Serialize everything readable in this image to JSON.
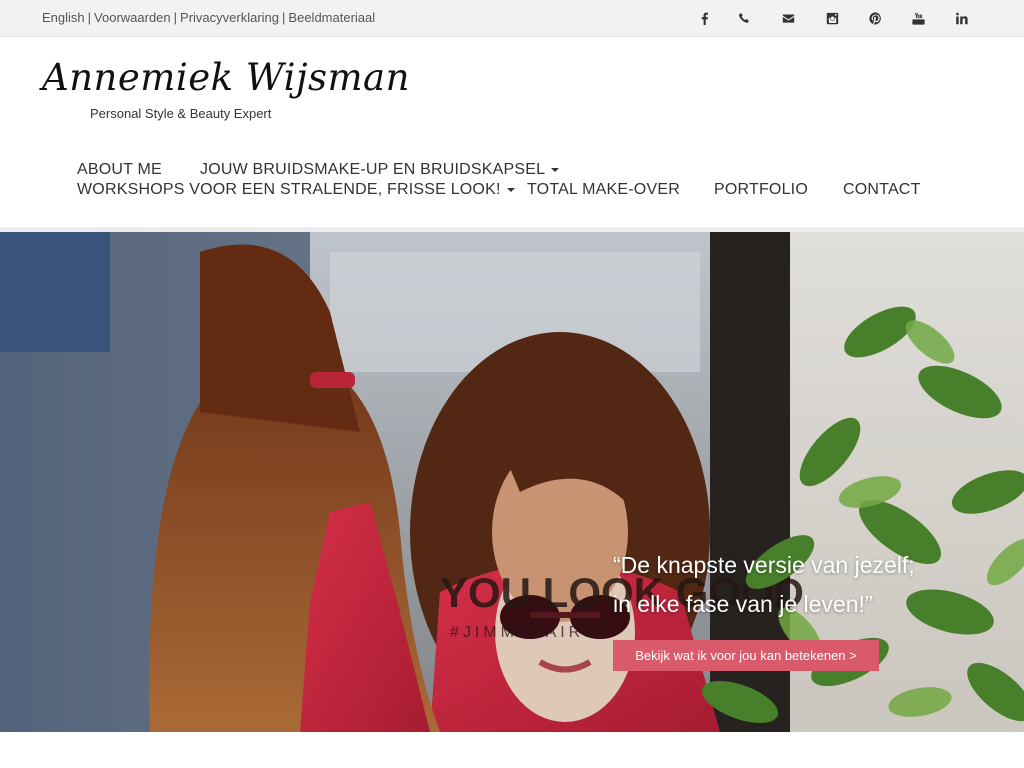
{
  "top_links": [
    {
      "label": "English"
    },
    {
      "label": "Voorwaarden"
    },
    {
      "label": "Privacyverklaring"
    },
    {
      "label": "Beeldmateriaal"
    }
  ],
  "link_separator": "|",
  "social_icons": [
    "facebook-icon",
    "phone-icon",
    "envelope-icon",
    "instagram-icon",
    "pinterest-icon",
    "youtube-icon",
    "linkedin-icon"
  ],
  "logo": {
    "name": "Annemiek Wijsman",
    "tagline": "Personal Style & Beauty Expert"
  },
  "nav": {
    "items": [
      {
        "label": "ABOUT ME",
        "dropdown": false
      },
      {
        "label": "JOUW BRUIDSMAKE-UP EN BRUIDSKAPSEL",
        "dropdown": true
      },
      {
        "label": "WORKSHOPS VOOR EEN STRALENDE, FRISSE LOOK!",
        "dropdown": true
      },
      {
        "label": "TOTAL MAKE-OVER",
        "dropdown": false
      },
      {
        "label": "PORTFOLIO",
        "dropdown": false
      },
      {
        "label": "CONTACT",
        "dropdown": false
      }
    ]
  },
  "hero": {
    "quote_line1": "“De knapste versie van jezelf;",
    "quote_line2": "in elke fase van je leven!”",
    "cta_label": "Bekijk wat ik voor jou kan betekenen >",
    "sign_text": "YOU LOOK GOOD",
    "sign_hashtag": "#JIMMYFAIRLY"
  },
  "colors": {
    "accent": "#d95b6b",
    "topbar": "#f2f2f2",
    "jacket": "#d8293f"
  }
}
